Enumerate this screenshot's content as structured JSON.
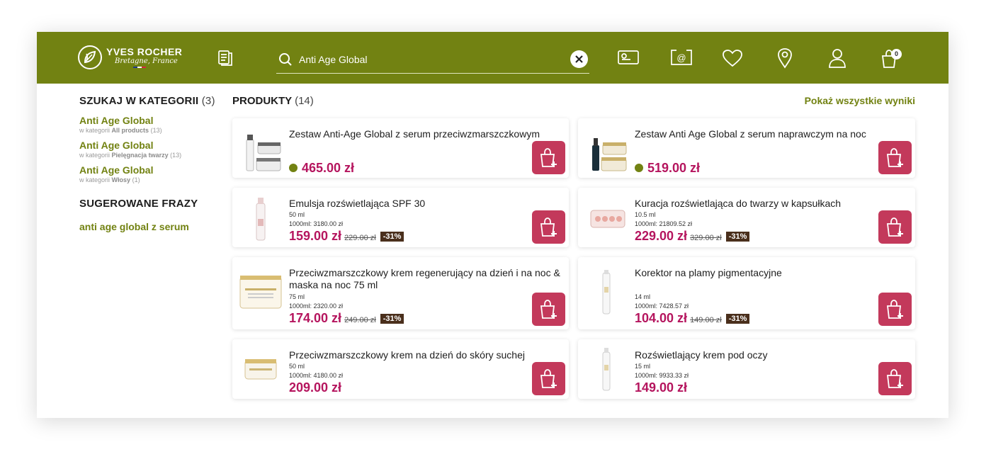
{
  "header": {
    "logo": {
      "brand": "YVES ROCHER",
      "sub": "Bretagne, France"
    },
    "search": {
      "value": "Anti Age Global"
    },
    "cart_count": "0",
    "colors": {
      "brand_green": "#728212",
      "price": "#b5155e",
      "cart_button": "#c3395b"
    },
    "icons": [
      "catalog-icon",
      "search-icon",
      "clear-icon",
      "gift-card-icon",
      "email-icon",
      "heart-icon",
      "location-icon",
      "user-icon",
      "cart-icon"
    ]
  },
  "sidebar": {
    "categories_title": "SZUKAJ W KATEGORII",
    "categories_count": "(3)",
    "categories": [
      {
        "name": "Anti Age Global",
        "prefix": "w kategorii",
        "category": "All products",
        "count": "(13)"
      },
      {
        "name": "Anti Age Global",
        "prefix": "w kategorii",
        "category": "Pielęgnacja twarzy",
        "count": "(13)"
      },
      {
        "name": "Anti Age Global",
        "prefix": "w kategorii",
        "category": "Włosy",
        "count": "(1)"
      }
    ],
    "phrases_title": "SUGEROWANE FRAZY",
    "phrases": [
      "anti age global z serum"
    ]
  },
  "results": {
    "title": "PRODUKTY",
    "count": "(14)",
    "show_all": "Pokaż wszystkie wyniki",
    "products": [
      {
        "name": "Zestaw Anti-Age Global z serum przeciwzmarszczkowym",
        "volume": "",
        "unit_price": "",
        "price": "465.00 zł",
        "old_price": "",
        "discount": "",
        "available_dot": true
      },
      {
        "name": "Zestaw Anti Age Global z serum naprawczym na noc",
        "volume": "",
        "unit_price": "",
        "price": "519.00 zł",
        "old_price": "",
        "discount": "",
        "available_dot": true
      },
      {
        "name": "Emulsja rozświetlająca SPF 30",
        "volume": "50 ml",
        "unit_price": "1000ml: 3180.00 zł",
        "price": "159.00 zł",
        "old_price": "229.00 zł",
        "discount": "-31%",
        "available_dot": false
      },
      {
        "name": "Kuracja rozświetlająca do twarzy w kapsułkach",
        "volume": "10.5 ml",
        "unit_price": "1000ml: 21809.52 zł",
        "price": "229.00 zł",
        "old_price": "329.00 zł",
        "discount": "-31%",
        "available_dot": false
      },
      {
        "name": "Przeciwzmarszczkowy krem regenerujący na dzień i na noc & maska na noc 75 ml",
        "volume": "75 ml",
        "unit_price": "1000ml: 2320.00 zł",
        "price": "174.00 zł",
        "old_price": "249.00 zł",
        "discount": "-31%",
        "available_dot": false
      },
      {
        "name": "Korektor na plamy pigmentacyjne",
        "volume": "14 ml",
        "unit_price": "1000ml: 7428.57 zł",
        "price": "104.00 zł",
        "old_price": "149.00 zł",
        "discount": "-31%",
        "available_dot": false
      },
      {
        "name": "Przeciwzmarszczkowy krem na dzień do skóry suchej",
        "volume": "50 ml",
        "unit_price": "1000ml: 4180.00 zł",
        "price": "209.00 zł",
        "old_price": "",
        "discount": "",
        "available_dot": false
      },
      {
        "name": "Rozświetlający krem pod oczy",
        "volume": "15 ml",
        "unit_price": "1000ml: 9933.33 zł",
        "price": "149.00 zł",
        "old_price": "",
        "discount": "",
        "available_dot": false
      }
    ]
  }
}
